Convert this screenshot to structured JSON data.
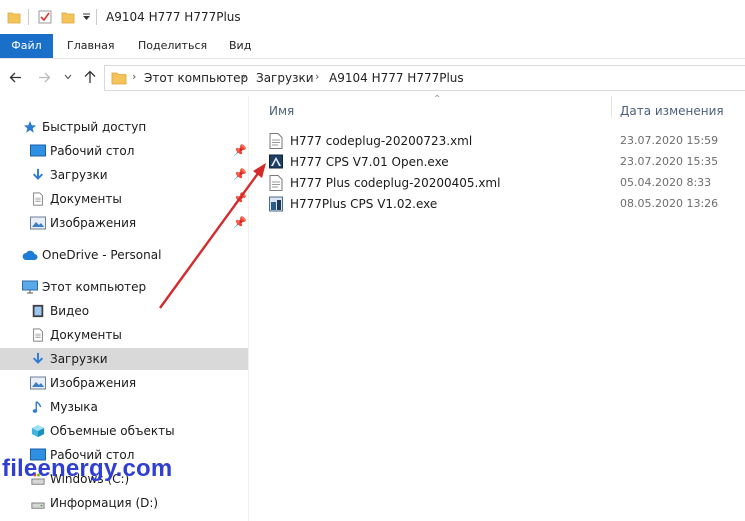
{
  "window": {
    "title": "A9104 H777 H777Plus"
  },
  "ribbon": {
    "tabs": [
      "Файл",
      "Главная",
      "Поделиться",
      "Вид"
    ]
  },
  "address": {
    "breadcrumbs": [
      "Этот компьютер",
      "Загрузки",
      "A9104 H777 H777Plus"
    ]
  },
  "sidebar": {
    "quick_access": {
      "label": "Быстрый доступ",
      "items": [
        "Рабочий стол",
        "Загрузки",
        "Документы",
        "Изображения"
      ]
    },
    "onedrive": {
      "label": "OneDrive - Personal"
    },
    "this_pc": {
      "label": "Этот компьютер",
      "items": [
        "Видео",
        "Документы",
        "Загрузки",
        "Изображения",
        "Музыка",
        "Объемные объекты",
        "Рабочий стол",
        "Windows (C:)",
        "Информация (D:)"
      ]
    }
  },
  "columns": {
    "name": "Имя",
    "date": "Дата изменения"
  },
  "files": [
    {
      "name": "H777 codeplug-20200723.xml",
      "date": "23.07.2020 15:59",
      "icon": "xml-file-icon"
    },
    {
      "name": "H777 CPS V7.01 Open.exe",
      "date": "23.07.2020 15:35",
      "icon": "exe-file-icon"
    },
    {
      "name": "H777 Plus codeplug-20200405.xml",
      "date": "05.04.2020 8:33",
      "icon": "xml-file-icon"
    },
    {
      "name": "H777Plus CPS V1.02.exe",
      "date": "08.05.2020 13:26",
      "icon": "exe-file-icon"
    }
  ],
  "watermark": "fileenergy.com",
  "colors": {
    "accent": "#1a6fc9",
    "selection": "#d9d9d9",
    "folder": "#f4c45b",
    "arrow": "#d42a2a",
    "watermark": "#2f3fd2"
  }
}
